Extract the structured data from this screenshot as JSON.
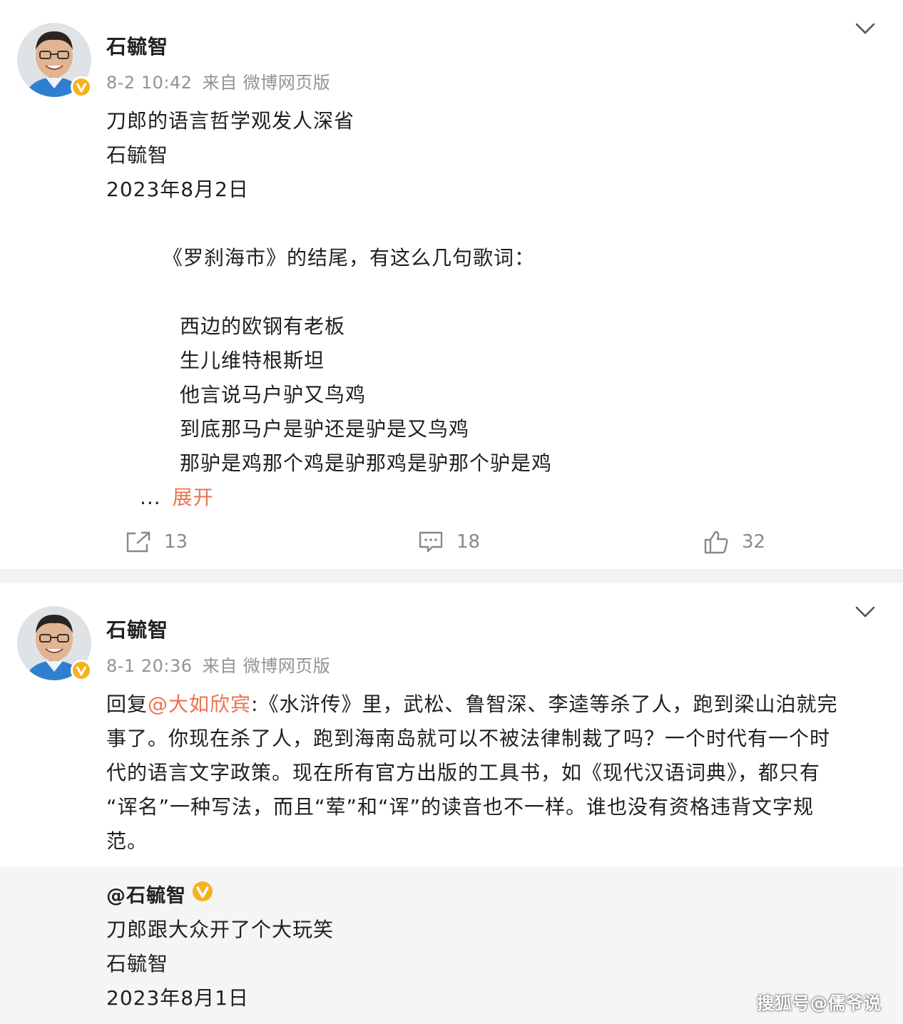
{
  "posts": [
    {
      "author": "石毓智",
      "time": "8-2 10:42",
      "source": "来自 微博网页版",
      "body_lines": [
        "刀郎的语言哲学观发人深省",
        "石毓智",
        "2023年8月2日",
        "《罗刹海市》的结尾，有这么几句歌词：",
        "西边的欧钢有老板",
        "生儿维特根斯坦",
        "他言说马户驴又鸟鸡",
        "到底那马户是驴还是驴是又鸟鸡",
        "那驴是鸡那个鸡是驴那鸡是驴那个驴是鸡"
      ],
      "ellipsis": "...",
      "expand_label": "展开",
      "reposts": "13",
      "comments": "18",
      "likes": "32"
    },
    {
      "author": "石毓智",
      "time": "8-1 20:36",
      "source": "来自 微博网页版",
      "reply_prefix": "回复",
      "reply_mention": "@大如欣宾",
      "body_lines": [
        ":《水浒传》里，武松、鲁智深、李逵等杀了人，跑到梁山泊就完",
        "事了。你现在杀了人，跑到海南岛就可以不被法律制裁了吗？一个时代有一个时",
        "代的语言文字政策。现在所有官方出版的工具书，如《现代汉语词典》，都只有",
        "“诨名”一种写法，而且“荤”和“诨”的读音也不一样。谁也没有资格违背文字规",
        "范。"
      ],
      "quote": {
        "author": "@石毓智",
        "lines": [
          "刀郎跟大众开了个大玩笑",
          "石毓智",
          "2023年8月1日"
        ]
      }
    }
  ],
  "watermark": "搜狐号@儒爷说",
  "colors": {
    "accent": "#eb7350",
    "verified_badge": "#f6b11d",
    "meta_text": "#939393",
    "quote_bg": "#f5f5f5"
  },
  "icons": {
    "repost": "repost-icon",
    "comment": "comment-icon",
    "like": "like-icon",
    "menu": "chevron-down-icon",
    "verified": "verified-badge-icon"
  }
}
